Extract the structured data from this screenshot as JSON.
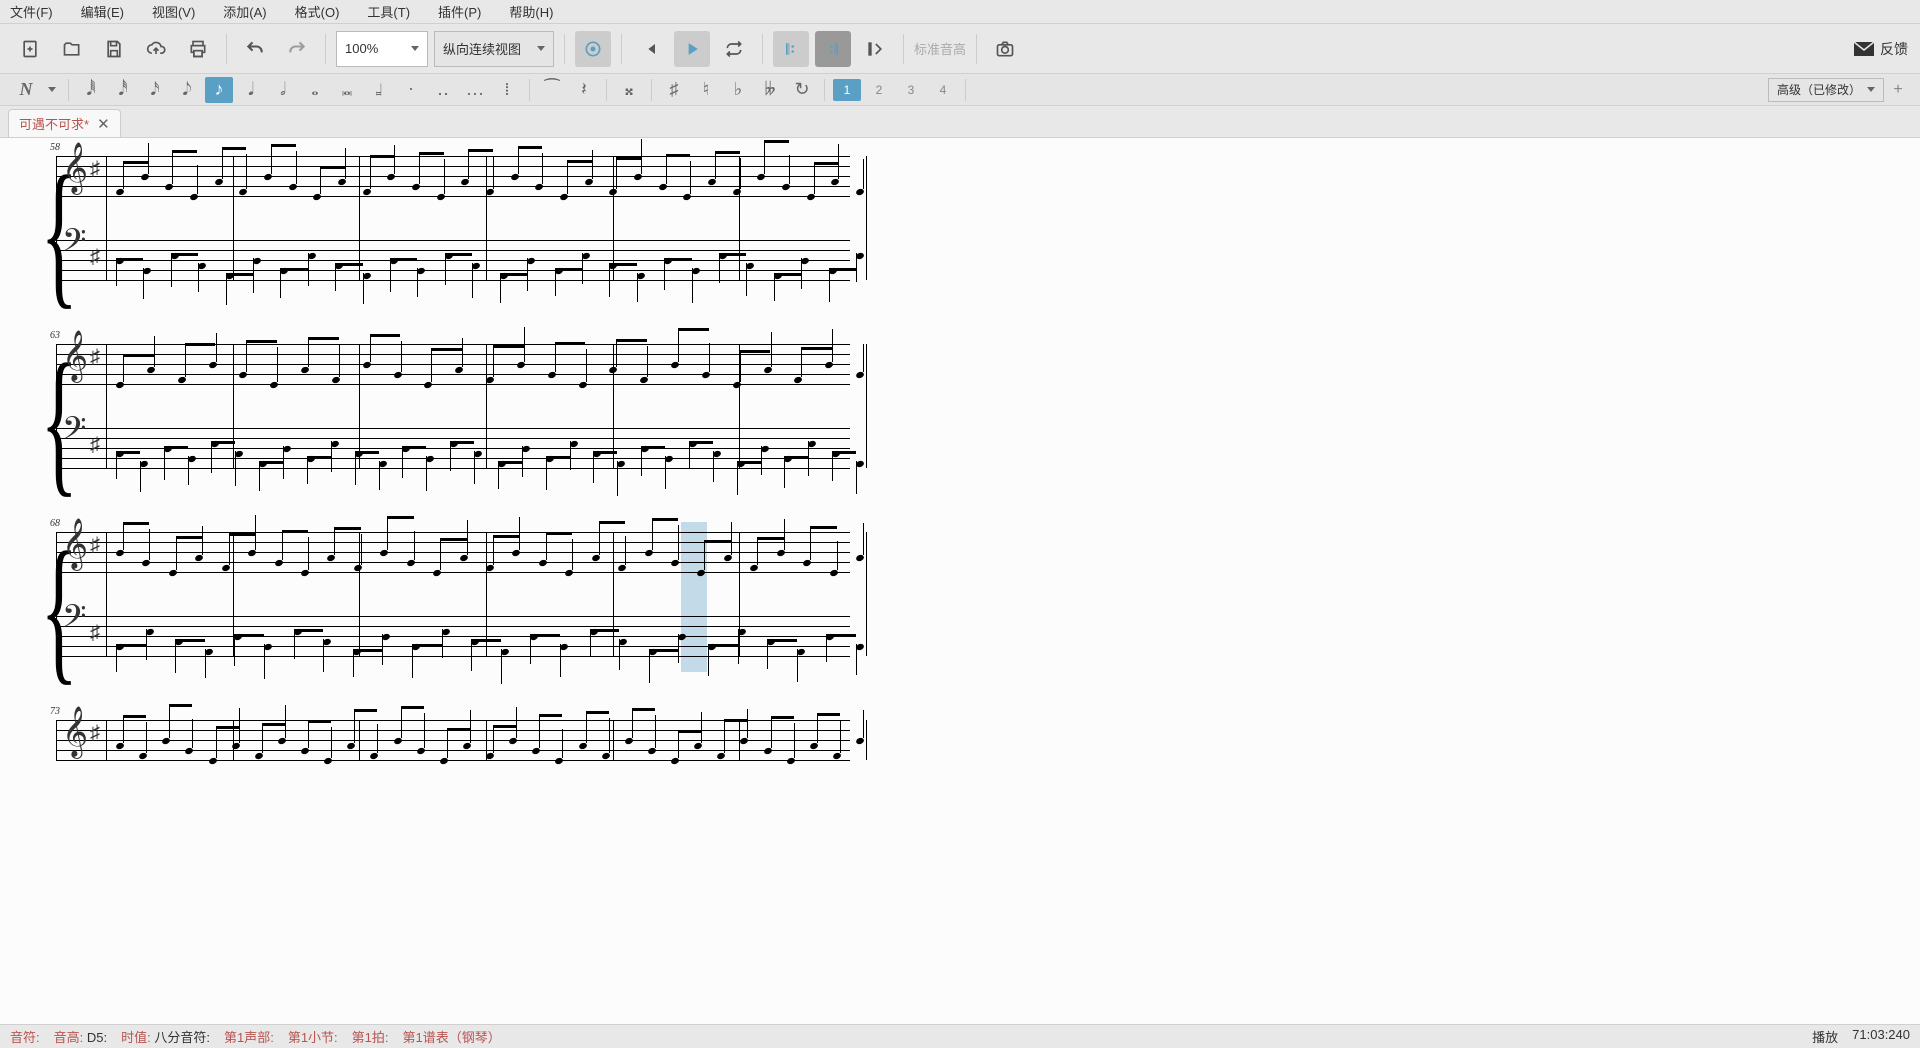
{
  "menu": {
    "file": "文件(F)",
    "edit": "编辑(E)",
    "view": "视图(V)",
    "add": "添加(A)",
    "format": "格式(O)",
    "tools": "工具(T)",
    "plugin": "插件(P)",
    "help": "帮助(H)"
  },
  "toolbar": {
    "zoom": "100%",
    "view_mode": "纵向连续视图",
    "pitch_label": "标准音高",
    "feedback": "反馈"
  },
  "voices": {
    "v1": "1",
    "v2": "2",
    "v3": "3",
    "v4": "4"
  },
  "workspace": {
    "selected": "高级（已修改）"
  },
  "tab": {
    "title": "可遇不可求*"
  },
  "score": {
    "systems": [
      {
        "measure": "58",
        "barlines": 6
      },
      {
        "measure": "63",
        "barlines": 6
      },
      {
        "measure": "68",
        "barlines": 6
      },
      {
        "measure": "73",
        "barlines": 6
      }
    ]
  },
  "status": {
    "note": "音符:",
    "pitch_label": "音高:",
    "pitch": "D5:",
    "dur_label": "时值:",
    "dur": "八分音符:",
    "voice_label": "第1声部:",
    "meas_label": "第1小节:",
    "beat_label": "第1拍:",
    "staff_label": "第1谱表（钢琴）",
    "play_label": "播放",
    "time": "71:03:240"
  }
}
